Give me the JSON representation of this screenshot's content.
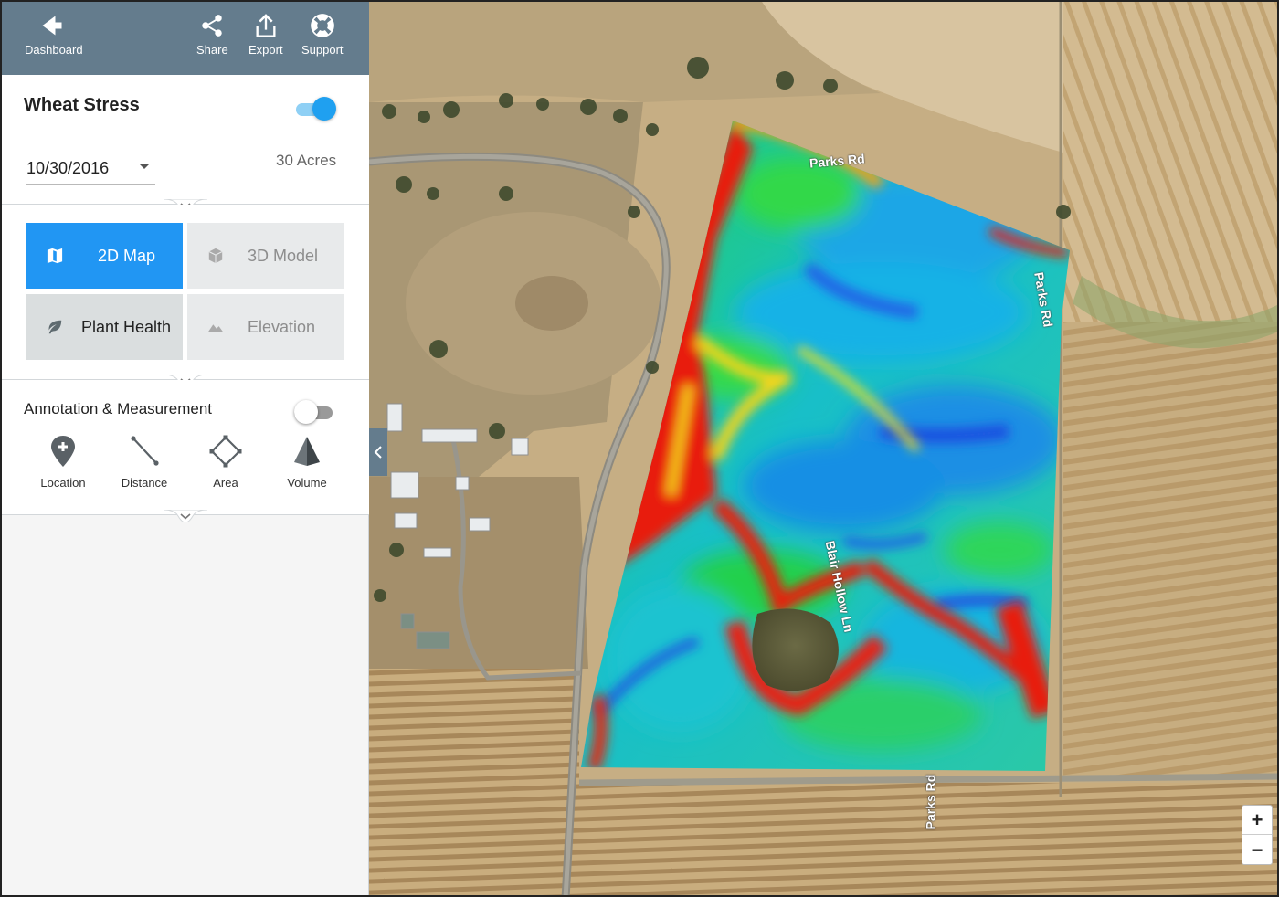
{
  "topbar": {
    "dashboard_label": "Dashboard",
    "share_label": "Share",
    "export_label": "Export",
    "support_label": "Support"
  },
  "layer": {
    "title": "Wheat Stress",
    "enabled": true,
    "date": "10/30/2016",
    "acres": "30 Acres"
  },
  "view_modes": {
    "map2d": "2D Map",
    "model3d": "3D Model",
    "plant_health": "Plant Health",
    "elevation": "Elevation",
    "active": "2D Map"
  },
  "annotation": {
    "title": "Annotation & Measurement",
    "enabled": false,
    "tools": {
      "location": "Location",
      "distance": "Distance",
      "area": "Area",
      "volume": "Volume"
    }
  },
  "map": {
    "road_labels": {
      "parks_top": "Parks Rd",
      "parks_mid": "Parks Rd",
      "blair": "Blair Hollow Ln",
      "parks_bottom": "Parks Rd"
    },
    "zoom_in": "+",
    "zoom_out": "−"
  },
  "colors": {
    "topbar": "#647c8d",
    "accent": "#2196f3",
    "stress_high": "#e81e0e",
    "stress_mid": "#f6e11a",
    "healthy": "#2ed34a",
    "cool": "#17b8e0",
    "low": "#1c5fe0"
  }
}
